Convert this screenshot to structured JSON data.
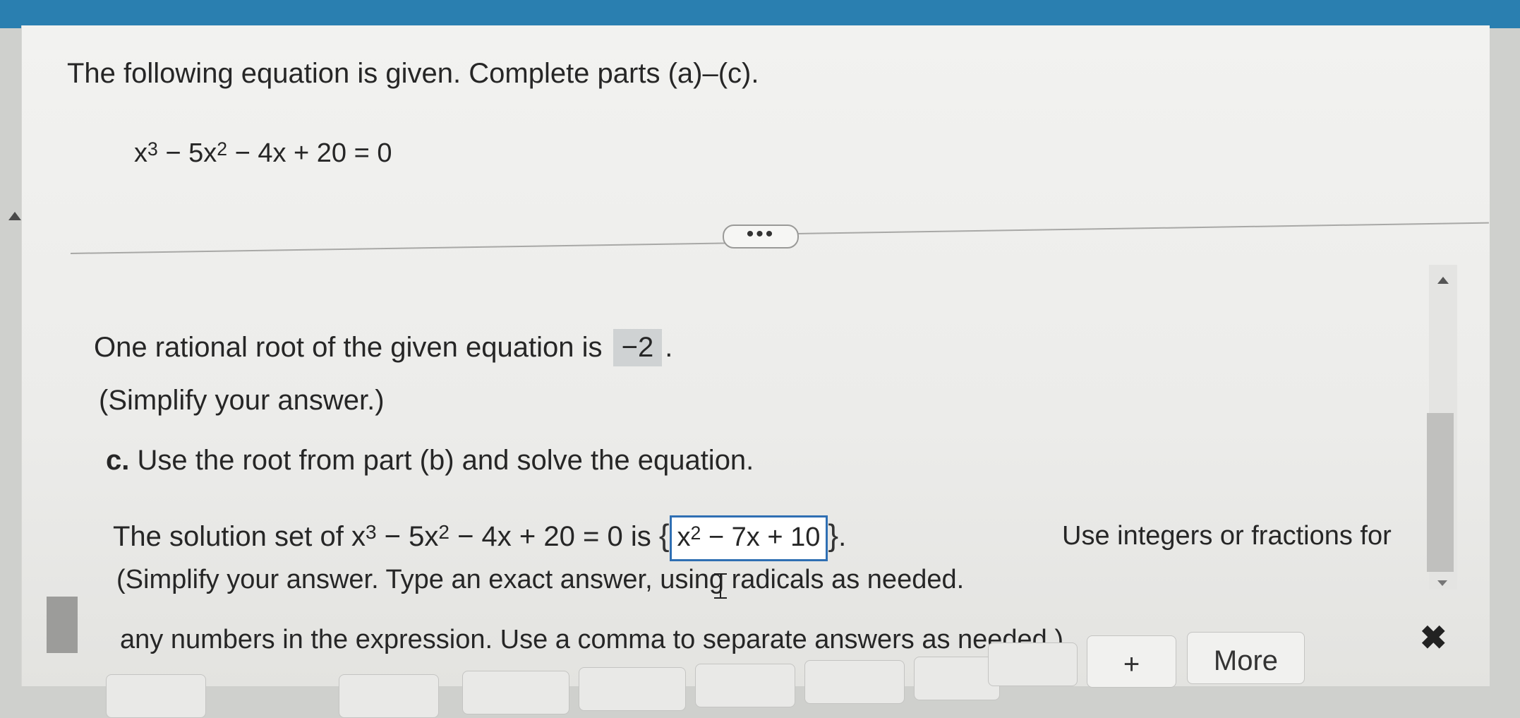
{
  "problem": {
    "prompt": "The following equation is given. Complete parts (a)–(c).",
    "equation_html": "x<sup>3</sup> − 5x<sup>2</sup> − 4x + 20 = 0"
  },
  "expand_label": "•••",
  "part_b": {
    "text_before": "One rational root of the given equation is",
    "answer": "−2",
    "text_after": ".",
    "simplify_note": "(Simplify your answer.)"
  },
  "part_c": {
    "letter": "c.",
    "instruction": "Use the root from part (b) and solve the equation.",
    "solution_prefix_html": "The solution set of x<sup>3</sup> − 5x<sup>2</sup> − 4x + 20 = 0 is",
    "brace_open": "{",
    "input_value_html": "x<sup>2</sup> − 7x + 10",
    "brace_close": "}",
    "period": ".",
    "instructions": [
      "Use integers or fractions for",
      "(Simplify your answer. Type an exact answer, using radicals as needed.",
      "any numbers in the expression. Use a comma to separate answers as needed.)"
    ]
  },
  "toolbar": {
    "plus_label": "+",
    "more_label": "More",
    "close_label": "✖"
  }
}
